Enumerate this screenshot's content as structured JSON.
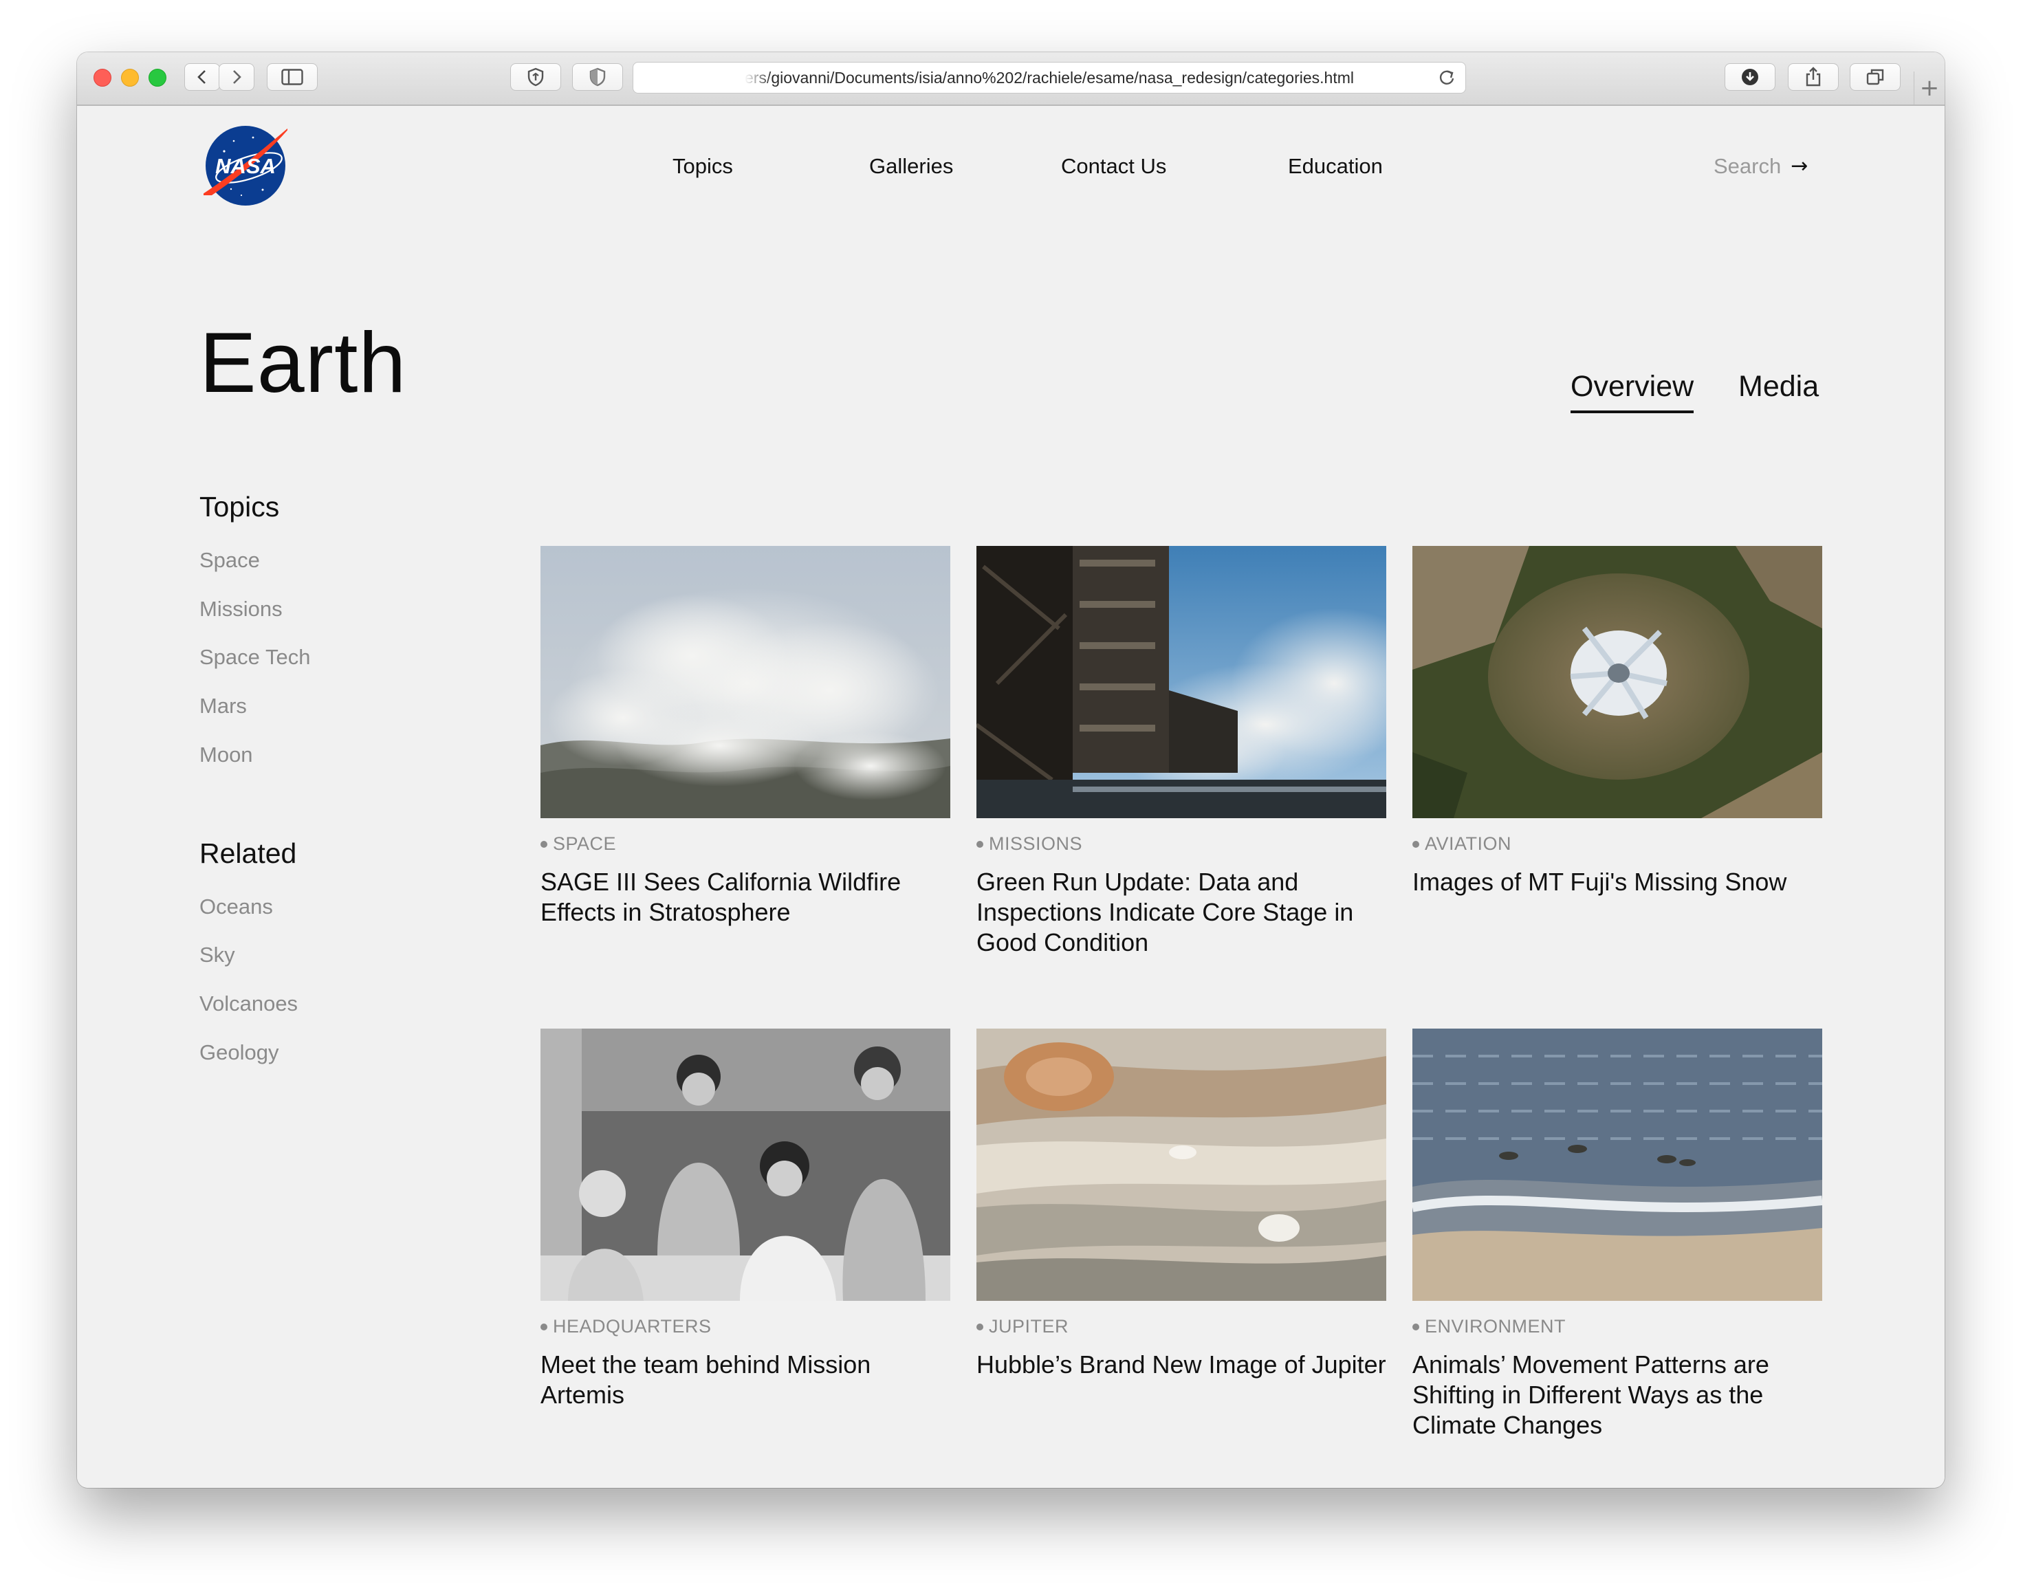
{
  "browser": {
    "url": "ers/giovanni/Documents/isia/anno%202/rachiele/esame/nasa_redesign/categories.html"
  },
  "header": {
    "logo_text": "NASA",
    "nav": [
      "Topics",
      "Galleries",
      "Contact Us",
      "Education"
    ],
    "search_label": "Search",
    "search_arrow": "→"
  },
  "page": {
    "title": "Earth",
    "tabs": [
      {
        "label": "Overview",
        "active": true
      },
      {
        "label": "Media",
        "active": false
      }
    ]
  },
  "sidebar": {
    "topics_heading": "Topics",
    "topics": [
      "Space",
      "Missions",
      "Space Tech",
      "Mars",
      "Moon"
    ],
    "related_heading": "Related",
    "related": [
      "Oceans",
      "Sky",
      "Volcanoes",
      "Geology"
    ]
  },
  "cards": [
    {
      "tag": "SPACE",
      "title": "SAGE III Sees California Wildfire Effects in Stratosphere"
    },
    {
      "tag": "MISSIONS",
      "title": "Green Run Update: Data and Inspections Indicate Core Stage in Good Condition"
    },
    {
      "tag": "AVIATION",
      "title": "Images of MT Fuji's Missing Snow"
    },
    {
      "tag": "HEADQUARTERS",
      "title": "Meet the team behind Mission Artemis"
    },
    {
      "tag": "JUPITER",
      "title": "Hubble’s Brand New Image of Jupiter"
    },
    {
      "tag": "ENVIRONMENT",
      "title": "Animals’ Movement Patterns are Shifting in Different Ways as the Climate Changes"
    }
  ],
  "colors": {
    "page_bg": "#f1f1f1",
    "text": "#111111",
    "muted": "#8a8a8a",
    "nasa_blue": "#0b3d91",
    "nasa_red": "#fc3d21"
  }
}
